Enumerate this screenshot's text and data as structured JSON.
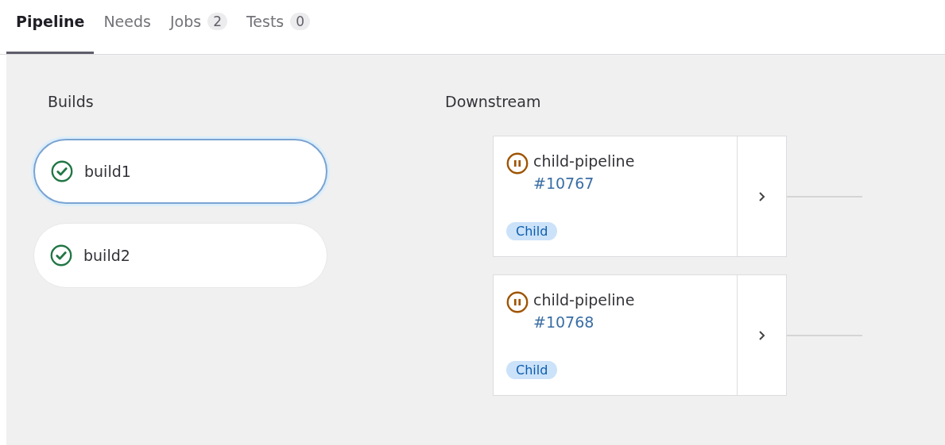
{
  "tabs": [
    {
      "label": "Pipeline",
      "selected": true
    },
    {
      "label": "Needs",
      "selected": false
    },
    {
      "label": "Jobs",
      "count": "2",
      "selected": false
    },
    {
      "label": "Tests",
      "count": "0",
      "selected": false
    }
  ],
  "builds": {
    "title": "Builds",
    "jobs": [
      {
        "name": "build1",
        "kind": "success",
        "selected": true
      },
      {
        "name": "build2",
        "kind": "success",
        "selected": false
      }
    ]
  },
  "downstream": {
    "title": "Downstream",
    "pipelines": [
      {
        "name": "child-pipeline",
        "id": "#10767",
        "kind": "manual",
        "tag": "Child"
      },
      {
        "name": "child-pipeline",
        "id": "#10768",
        "kind": "manual",
        "tag": "Child"
      }
    ]
  }
}
